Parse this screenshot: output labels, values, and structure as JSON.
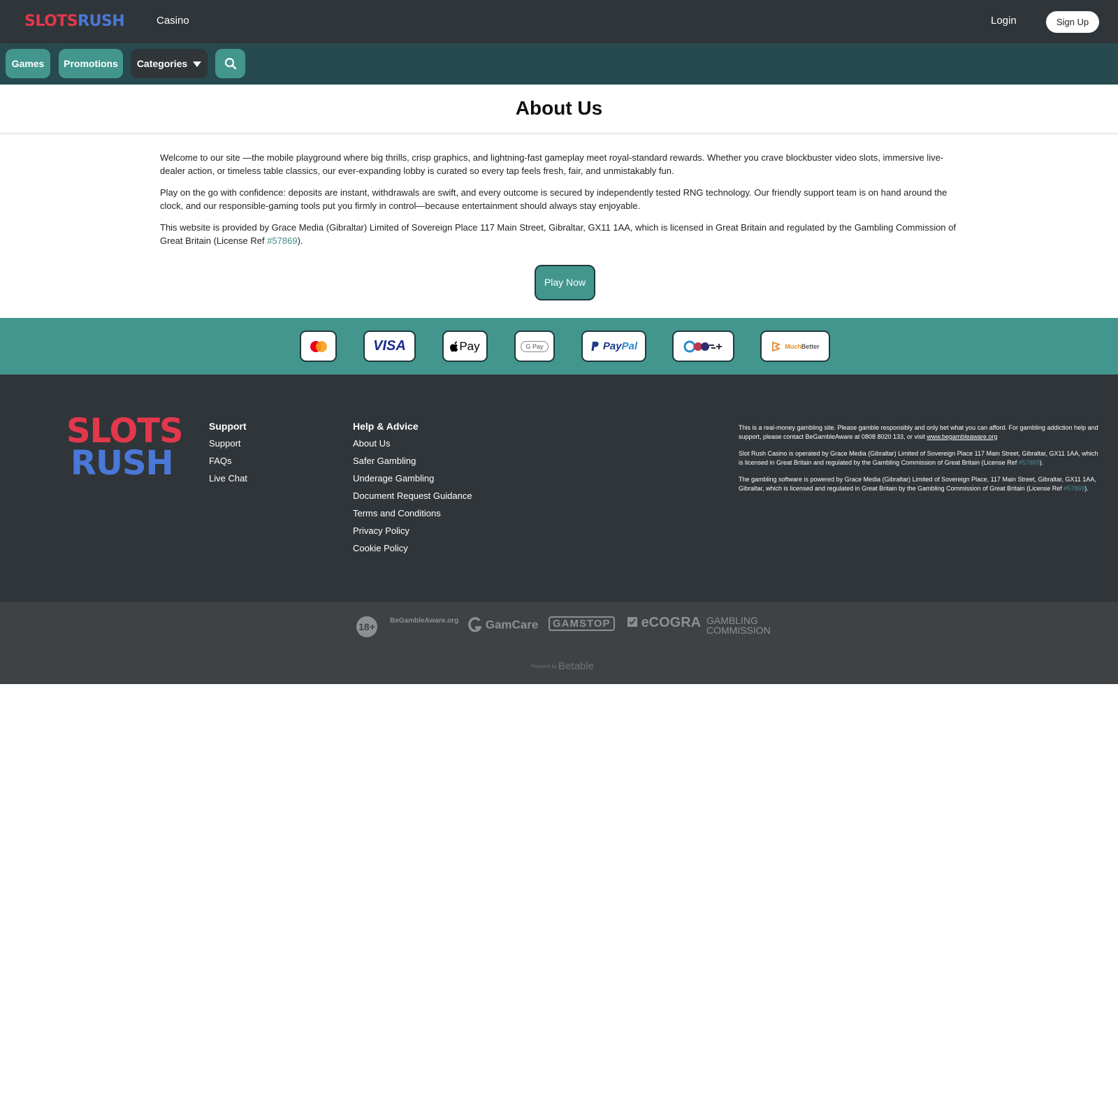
{
  "header": {
    "logo": "SLOTS RUSH",
    "nav_casino": "Casino",
    "login": "Login",
    "signup": "Sign Up"
  },
  "nav": {
    "games": "Games",
    "promotions": "Promotions",
    "categories": "Categories",
    "search_icon": "search-icon"
  },
  "page": {
    "title": "About Us",
    "paragraphs": [
      "Welcome to our site —the mobile playground where big thrills, crisp graphics, and lightning-fast gameplay meet royal-standard rewards. Whether you crave blockbuster video slots, immersive live-dealer action, or timeless table classics, our ever-expanding lobby is curated so every tap feels fresh, fair, and unmistakably fun.",
      "Play on the go with confidence: deposits are instant, withdrawals are swift, and every outcome is secured by independently tested RNG technology. Our friendly support team is on hand around the clock, and our responsible-gaming tools put you firmly in control—because entertainment should always stay enjoyable."
    ],
    "license_text_before": "This website is provided by Grace Media (Gibraltar) Limited of Sovereign Place 117 Main Street, Gibraltar, GX11 1AA, which is licensed in Great Britain and regulated by the Gambling Commission of Great Britain (License Ref ",
    "license_ref": "#57869",
    "license_text_after": ").",
    "cta": "Play Now"
  },
  "payments": {
    "visa": "VISA",
    "applepay": "Pay",
    "gpay": "G Pay",
    "paypal_pay": "Pay",
    "paypal_pal": "Pal",
    "muchbetter_much": "Much",
    "muchbetter_better": "Better"
  },
  "footer": {
    "logo_top": "SLOTS",
    "logo_bottom": "RUSH",
    "support": {
      "heading": "Support",
      "links": [
        "Support",
        "FAQs",
        "Live Chat"
      ]
    },
    "help": {
      "heading": "Help & Advice",
      "links": [
        "About Us",
        "Safer Gambling",
        "Underage Gambling",
        "Document Request Guidance",
        "Terms and Conditions",
        "Privacy Policy",
        "Cookie Policy"
      ]
    },
    "disclaimer": {
      "p1_text": "This is a real-money gambling site. Please gamble responsibly and only bet what you can afford. For gambling addiction help and support, please contact BeGambleAware at 0808 8020 133, or visit ",
      "p1_link": "www.begambleaware.org",
      "p2_text": "Slot Rush Casino is operated by Grace Media (Gibraltar) Limited of Sovereign Place 117 Main Street, Gibraltar, GX11 1AA, which is licensed in Great Britain and regulated by the Gambling Commission of Great Britain (License Ref ",
      "p2_ref": "#57869",
      "p2_end": ").",
      "p3_text": "The gambling software is powered by Grace Media (Gibraltar) Limited of Sovereign Place, 117 Main Street, Gibraltar, GX11 1AA, Gibraltar, which is licensed and regulated in Great Britain by the Gambling Commission of Great Britain (License Ref ",
      "p3_ref": "#57869",
      "p3_end": ")."
    }
  },
  "bottom": {
    "age": "18+",
    "begambleaware": "BeGambleAware.org",
    "gamcare": "GamCare",
    "gamstop": "GAMSTOP",
    "ecogra": "eCOGRA",
    "gambling_commission": "GAMBLING COMMISSION",
    "powered_small": "Powered by",
    "powered_brand": "Betable"
  },
  "colors": {
    "header_bg": "#303539",
    "nav_bg": "#264a4f",
    "accent": "#43968e",
    "footer_bg": "#303539",
    "bottom_bg": "#3e4245"
  }
}
